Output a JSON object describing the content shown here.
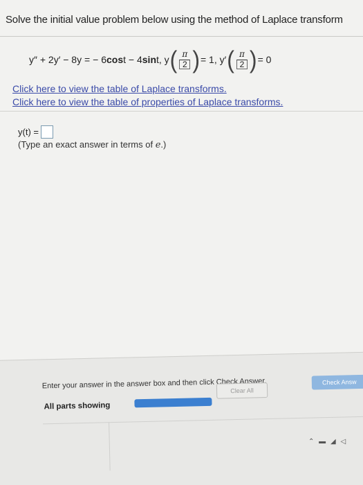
{
  "header": {
    "instruction": "Solve the initial value problem below using the method of Laplace transform"
  },
  "equation": {
    "lhs": "y″ + 2y′ − 8y = ",
    "rhs_a": "− 6 ",
    "cos": "cos",
    "rhs_b": " t − 4 ",
    "sin": "sin",
    "rhs_c": " t, y",
    "cond1_num": "π",
    "cond1_den": "2",
    "cond1_val": " = 1, y′",
    "cond2_num": "π",
    "cond2_den": "2",
    "cond2_val": " = 0"
  },
  "links": {
    "laplace_table": "Click here to view the table of Laplace transforms.",
    "properties_table": "Click here to view the table of properties of Laplace transforms."
  },
  "answer": {
    "label": "y(t) =",
    "value": "",
    "hint_prefix": "(Type an exact answer in terms of ",
    "hint_var": "e",
    "hint_suffix": ".)"
  },
  "footer": {
    "instruction": "Enter your answer in the answer box and then click Check Answer.",
    "parts_status": "All parts showing",
    "progress": 1.0,
    "clear_all": "Clear All",
    "check_answer": "Check Answ"
  },
  "colors": {
    "link": "#3a4aa8",
    "progress": "#3b7fd0",
    "check_button": "#8fb7e0"
  }
}
